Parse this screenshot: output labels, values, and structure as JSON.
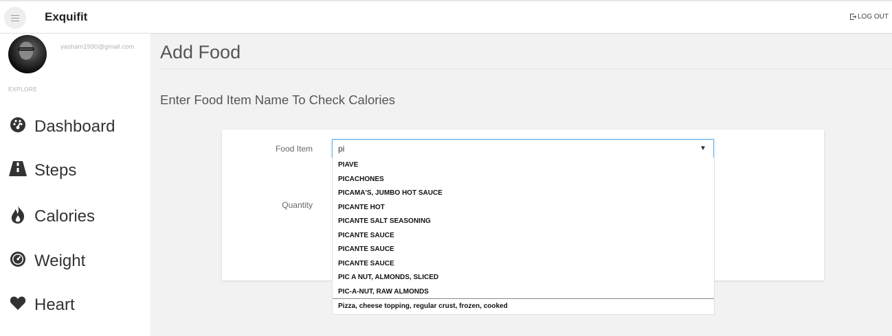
{
  "header": {
    "app_name": "Exquifit",
    "logout_label": "LOG OUT",
    "menu_icon": "hamburger-menu-icon",
    "logout_icon": "sign-out-icon"
  },
  "sidebar": {
    "email": "yasham1990@gmail.com",
    "section_label": "EXPLORE",
    "items": [
      {
        "label": "Dashboard",
        "icon": "tachometer-icon"
      },
      {
        "label": "Steps",
        "icon": "road-icon"
      },
      {
        "label": "Calories",
        "icon": "fire-icon"
      },
      {
        "label": "Weight",
        "icon": "gauge-icon"
      },
      {
        "label": "Heart",
        "icon": "heart-icon"
      }
    ]
  },
  "main": {
    "title": "Add Food",
    "subtitle": "Enter Food Item Name To Check Calories",
    "form": {
      "food_item_label": "Food Item",
      "food_item_value": "pi",
      "quantity_label": "Quantity"
    },
    "dropdown_options": [
      "PIAVE",
      "PICACHONES",
      "PICAMA'S, JUMBO HOT SAUCE",
      "PICANTE HOT",
      "PICANTE SALT SEASONING",
      "PICANTE SAUCE",
      "PICANTE SAUCE",
      "PICANTE SAUCE",
      "PIC A NUT, ALMONDS, SLICED",
      "PIC-A-NUT, RAW ALMONDS",
      "Pizza, cheese topping, regular crust, frozen, cooked"
    ]
  },
  "colors": {
    "accent_focus": "#66afe9",
    "background": "#f2f2f2",
    "card": "#ffffff"
  }
}
